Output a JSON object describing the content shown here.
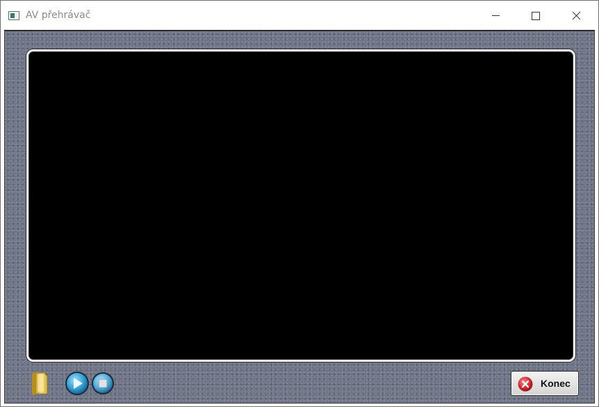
{
  "window": {
    "title": "AV přehrávač"
  },
  "controls": {
    "open_icon": "folder-icon",
    "play_icon": "play-icon",
    "stop_icon": "stop-icon",
    "exit_label": "Konec",
    "exit_icon": "close-circle-icon"
  },
  "colors": {
    "panel": "#6d7385",
    "video_background": "#000000",
    "exit_icon_red": "#d9252a",
    "play_blue": "#2f9fd6"
  }
}
